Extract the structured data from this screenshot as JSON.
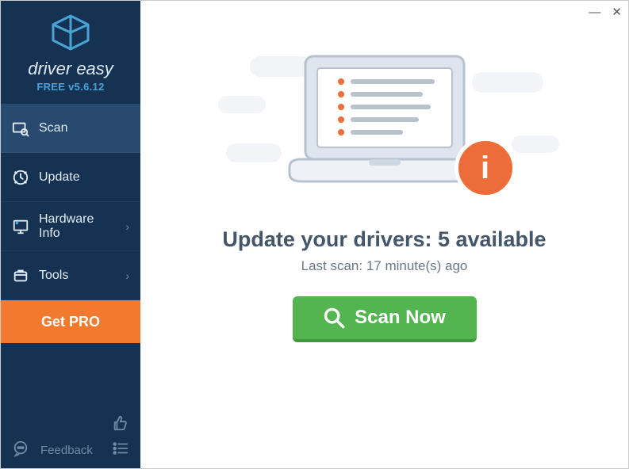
{
  "brand": {
    "name": "driver easy",
    "version": "FREE v5.6.12"
  },
  "sidebar": {
    "items": [
      {
        "label": "Scan"
      },
      {
        "label": "Update"
      },
      {
        "label": "Hardware Info"
      },
      {
        "label": "Tools"
      }
    ],
    "getPro": "Get PRO",
    "feedback": "Feedback"
  },
  "main": {
    "headline": "Update your drivers: 5 available",
    "subline": "Last scan: 17 minute(s) ago",
    "scanButton": "Scan Now",
    "infoBadge": "i"
  }
}
